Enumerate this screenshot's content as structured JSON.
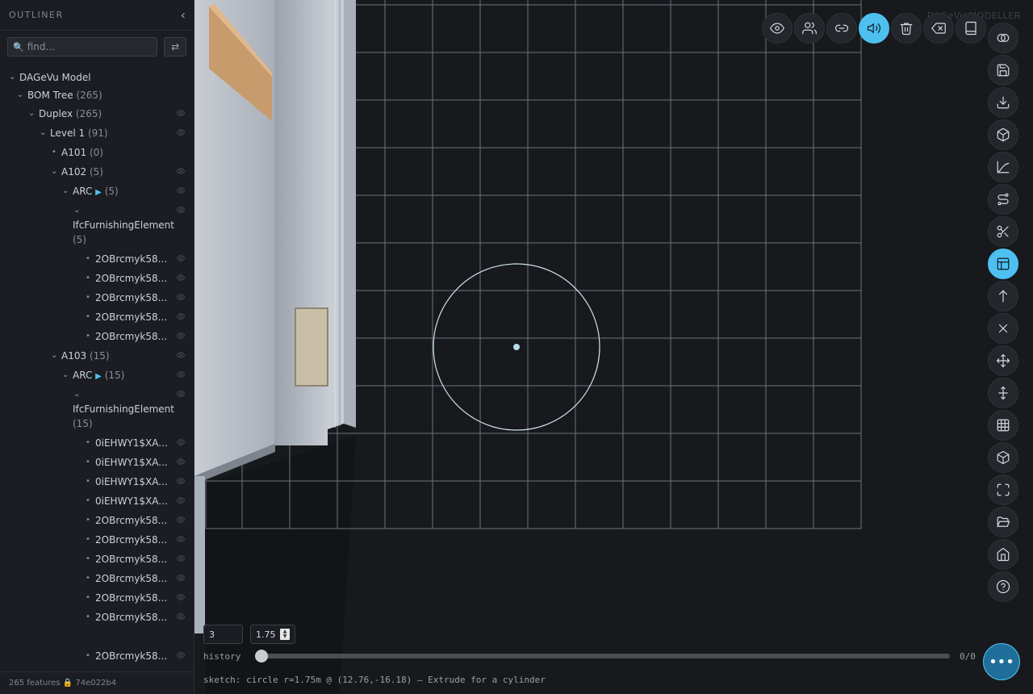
{
  "sidebar": {
    "title": "OUTLINER",
    "search_placeholder": "find...",
    "tree": [
      {
        "label": "DAGeVu Model",
        "count": ""
      },
      {
        "label": "BOM Tree",
        "count": "(265)"
      },
      {
        "label": "Duplex",
        "count": "(265)"
      },
      {
        "label": "Level 1",
        "count": "(91)"
      },
      {
        "label": "A101",
        "count": "(0)"
      },
      {
        "label": "A102",
        "count": "(5)"
      },
      {
        "label": "ARC",
        "play": "▶",
        "count": "(5)"
      },
      {
        "label": "IfcFurnishingElement",
        "count": "(5)"
      },
      {
        "label": "2OBrcmyk58..."
      },
      {
        "label": "2OBrcmyk58..."
      },
      {
        "label": "2OBrcmyk58..."
      },
      {
        "label": "2OBrcmyk58..."
      },
      {
        "label": "2OBrcmyk58..."
      },
      {
        "label": "A103",
        "count": "(15)"
      },
      {
        "label": "ARC",
        "play": "▶",
        "count": "(15)"
      },
      {
        "label": "IfcFurnishingElement",
        "count": "(15)"
      },
      {
        "label": "0iEHWY1$XA..."
      },
      {
        "label": "0iEHWY1$XA..."
      },
      {
        "label": "0iEHWY1$XA..."
      },
      {
        "label": "0iEHWY1$XA..."
      },
      {
        "label": "2OBrcmyk58..."
      },
      {
        "label": "2OBrcmyk58..."
      },
      {
        "label": "2OBrcmyk58..."
      },
      {
        "label": "2OBrcmyk58..."
      },
      {
        "label": "2OBrcmyk58..."
      },
      {
        "label": "2OBrcmyk58..."
      },
      {
        "label": "2OBrcmyk58..."
      }
    ],
    "footer": "265 features 🔒 74e022b4"
  },
  "viewport": {
    "watermark": "DAGeVu MODELLER",
    "top_toolbar": [
      "eye-icon",
      "users-icon",
      "link-icon",
      "volume-icon",
      "trash-icon",
      "backspace-icon",
      "book-icon"
    ],
    "side_toolbar": [
      "boolean-icon",
      "save-icon",
      "download-icon",
      "box-icon",
      "curve-icon",
      "route-icon",
      "scissors-icon",
      "layout-icon",
      "arrow-up-icon",
      "x-icon",
      "move-icon",
      "move-vertical-icon",
      "grid-icon",
      "cube-icon",
      "fullscreen-icon",
      "folder-open-icon",
      "home-icon",
      "help-icon"
    ],
    "accent": "#4ec0f0",
    "segments_value": "3",
    "radius_value": "1.75",
    "history_label": "history",
    "history_count": "0/0",
    "history_progress": 0,
    "status": "sketch: circle r=1.75m @ (12.76,-16.18) — Extrude for a cylinder"
  }
}
